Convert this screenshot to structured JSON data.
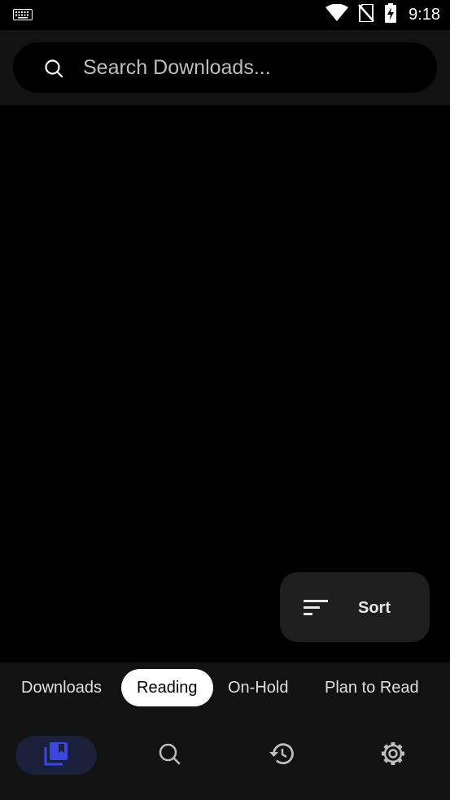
{
  "status_bar": {
    "time": "9:18"
  },
  "search": {
    "placeholder": "Search Downloads..."
  },
  "sort_button": {
    "label": "Sort"
  },
  "category_tabs": [
    {
      "label": "Downloads",
      "active": false
    },
    {
      "label": "Reading",
      "active": true
    },
    {
      "label": "On-Hold",
      "active": false
    },
    {
      "label": "Plan to Read",
      "active": false
    }
  ],
  "bottom_nav": [
    {
      "icon": "library-icon",
      "active": true
    },
    {
      "icon": "search-icon",
      "active": false
    },
    {
      "icon": "history-icon",
      "active": false
    },
    {
      "icon": "settings-icon",
      "active": false
    }
  ],
  "colors": {
    "background": "#000000",
    "surface": "#121212",
    "accent": "#3b46e0",
    "fab": "#1e1e1e"
  }
}
